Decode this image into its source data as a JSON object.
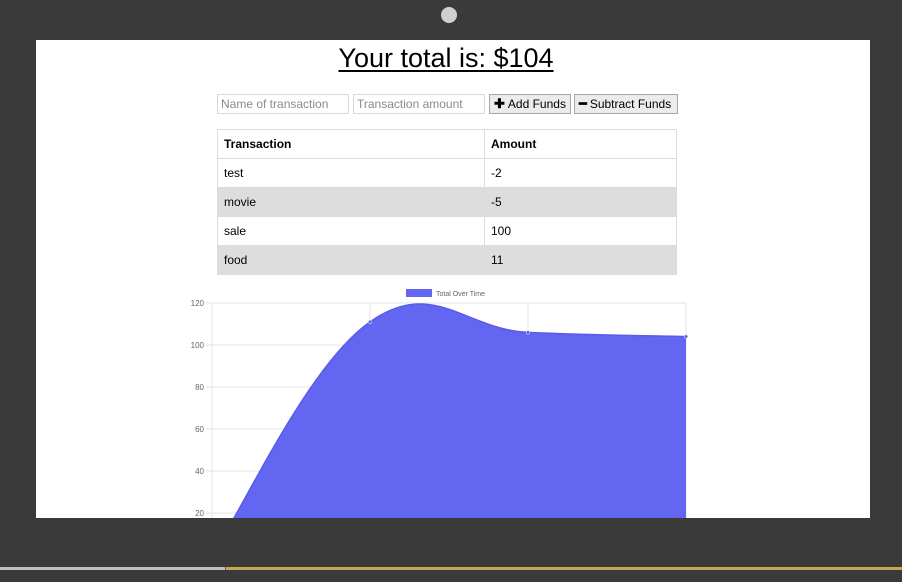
{
  "header": {
    "title": "Your total is: $104"
  },
  "form": {
    "name_placeholder": "Name of transaction",
    "amount_placeholder": "Transaction amount",
    "add_label": "Add Funds",
    "add_icon": "plus-icon",
    "subtract_label": "Subtract Funds",
    "subtract_icon": "minus-icon"
  },
  "table": {
    "headers": [
      "Transaction",
      "Amount"
    ],
    "rows": [
      {
        "name": "test",
        "amount": "-2"
      },
      {
        "name": "movie",
        "amount": "-5"
      },
      {
        "name": "sale",
        "amount": "100"
      },
      {
        "name": "food",
        "amount": "11"
      }
    ]
  },
  "chart_data": {
    "type": "area",
    "series": [
      {
        "name": "Total Over Time",
        "color": "#6366f1",
        "values": [
          0,
          111,
          106,
          104
        ]
      }
    ],
    "x": [
      0,
      1,
      2,
      3
    ],
    "ylim": [
      0,
      120
    ],
    "yticks": [
      20,
      40,
      60,
      80,
      100,
      120
    ],
    "legend_position": "top",
    "grid": true
  },
  "progress": {
    "fraction": 0.25
  },
  "colors": {
    "frame": "#3a3a3a",
    "screen": "#ffffff",
    "area_fill": "#6366f1",
    "row_alt": "#dddddd",
    "progress_fill": "#c8a84f"
  }
}
